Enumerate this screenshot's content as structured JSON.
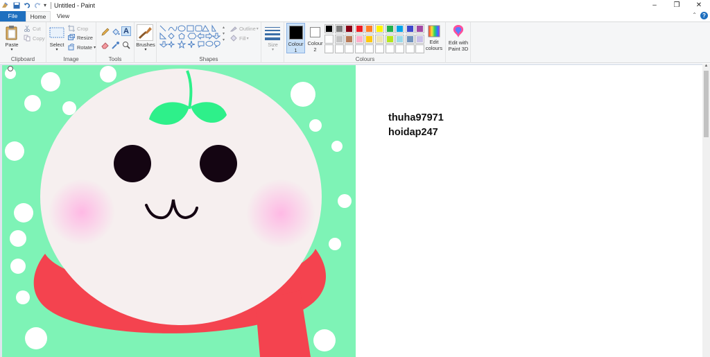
{
  "window": {
    "title": "Untitled - Paint",
    "minimize_glyph": "–",
    "restore_glyph": "❐",
    "close_glyph": "✕"
  },
  "quick_access": {
    "dropdown_glyph": "▾"
  },
  "tabs": [
    {
      "label": "File",
      "active": false
    },
    {
      "label": "Home",
      "active": true
    },
    {
      "label": "View",
      "active": false
    }
  ],
  "help_glyph": "?",
  "ribbon": {
    "clipboard": {
      "label": "Clipboard",
      "paste": "Paste",
      "cut": "Cut",
      "copy": "Copy"
    },
    "image": {
      "label": "Image",
      "select": "Select",
      "crop": "Crop",
      "resize": "Resize",
      "rotate": "Rotate"
    },
    "tools": {
      "label": "Tools",
      "text_glyph": "A"
    },
    "brushes": {
      "label": "Brushes"
    },
    "shapes": {
      "label": "Shapes",
      "outline": "Outline",
      "fill": "Fill"
    },
    "size": {
      "label": "Size"
    },
    "colours": {
      "label": "Colours",
      "colour1_label": "Colour 1",
      "colour2_label": "Colour 2",
      "colour1": "#000000",
      "colour2": "#ffffff",
      "edit_colours": "Edit colours",
      "edit_paint3d": "Edit with Paint 3D",
      "palette_row1": [
        "#000000",
        "#7f7f7f",
        "#880015",
        "#ed1c24",
        "#ff7f27",
        "#fff200",
        "#22b14c",
        "#00a2e8",
        "#3f48cc",
        "#a349a4"
      ],
      "palette_row2": [
        "#ffffff",
        "#c3c3c3",
        "#b97a57",
        "#ffaec9",
        "#ffc90e",
        "#efe4b0",
        "#b5e61d",
        "#99d9ea",
        "#7092be",
        "#c8bfe7"
      ],
      "palette_row3": [
        "#ffffff",
        "#ffffff",
        "#ffffff",
        "#ffffff",
        "#ffffff",
        "#ffffff",
        "#ffffff",
        "#ffffff",
        "#ffffff",
        "#ffffff"
      ]
    }
  },
  "canvas": {
    "background_color": "#7ef3b6",
    "face_color": "#f6efef",
    "scarf_color": "#f4434f",
    "leaf_color": "#2ef08a",
    "cheek_color": "#ffb6e4",
    "eye_color": "#140512",
    "text_lines": [
      "thuha97971",
      "hoidap247"
    ]
  }
}
